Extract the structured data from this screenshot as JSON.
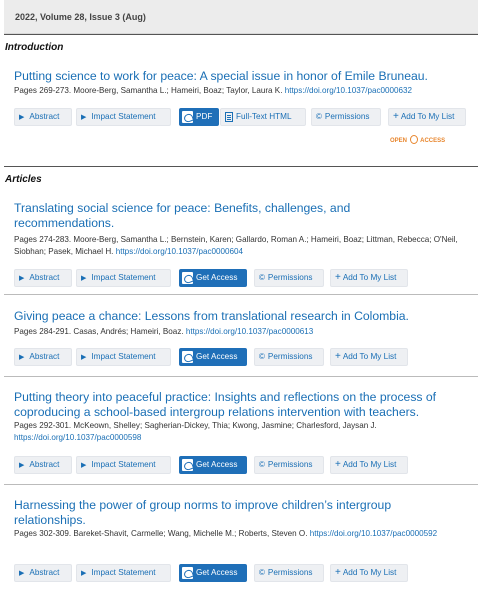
{
  "issue": {
    "label": "2022, Volume 28, Issue 3 (Aug)"
  },
  "actions": {
    "abstract": "Abstract",
    "impact": "Impact Statement",
    "pdf": "PDF",
    "fulltext": "Full-Text HTML",
    "permissions": "Permissions",
    "add": "Add To My List",
    "get_access": "Get Access",
    "open_access": "OPEN ACCESS"
  },
  "sections": [
    {
      "title": "Introduction",
      "articles": [
        {
          "title": "Putting science to work for peace: A special issue in honor of Emile Bruneau.",
          "meta": "Pages 269-273. Moore-Berg, Samantha L.; Hameiri, Boaz; Taylor, Laura K.",
          "doi": "https://doi.org/10.1037/pac0000632"
        }
      ]
    },
    {
      "title": "Articles",
      "articles": [
        {
          "title": "Translating social science for peace: Benefits, challenges, and recommendations.",
          "meta": "Pages 274-283. Moore-Berg, Samantha L.; Bernstein, Karen; Gallardo, Roman A.; Hameiri, Boaz; Littman, Rebecca; O'Neil, Siobhan; Pasek, Michael H.",
          "doi": "https://doi.org/10.1037/pac0000604"
        },
        {
          "title": "Giving peace a chance: Lessons from translational research in Colombia.",
          "meta": "Pages 284-291. Casas, Andrés; Hameiri, Boaz.",
          "doi": "https://doi.org/10.1037/pac0000613"
        },
        {
          "title": "Putting theory into peaceful practice: Insights and reflections on the process of coproducing a school-based intergroup relations intervention with teachers.",
          "meta": "Pages 292-301. McKeown, Shelley; Sagherian-Dickey, Thia; Kwong, Jasmine; Charlesford, Jaysan J.",
          "doi": "https://doi.org/10.1037/pac0000598"
        },
        {
          "title": "Harnessing the power of group norms to improve children’s intergroup relationships.",
          "meta": "Pages 302-309. Bareket-Shavit, Carmelle; Wang, Michelle M.; Roberts, Steven O.",
          "doi": "https://doi.org/10.1037/pac0000592"
        }
      ]
    }
  ]
}
